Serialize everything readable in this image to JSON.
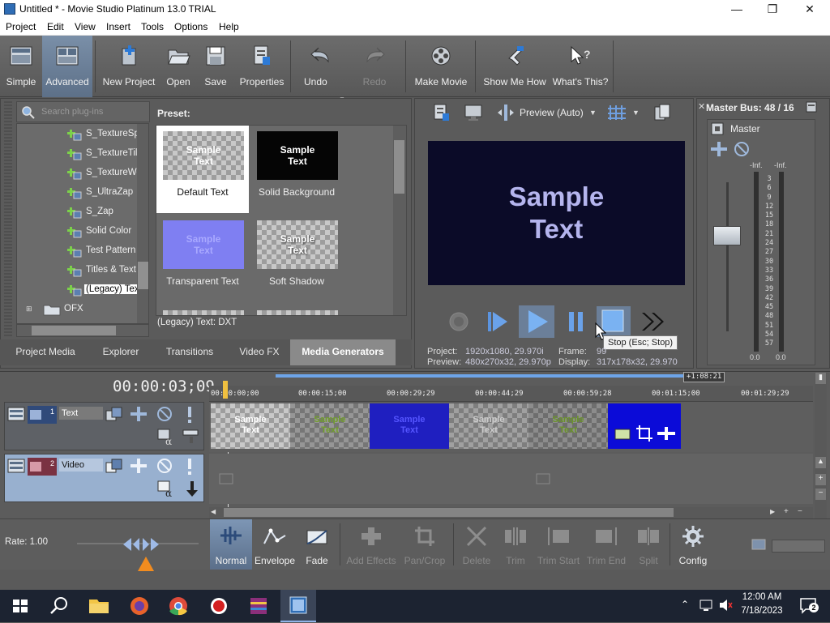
{
  "window": {
    "title": "Untitled * - Movie Studio Platinum 13.0 TRIAL",
    "min": "—",
    "max": "❐",
    "close": "✕"
  },
  "menu": [
    "Project",
    "Edit",
    "View",
    "Insert",
    "Tools",
    "Options",
    "Help"
  ],
  "toolbar": {
    "simple": "Simple",
    "advanced": "Advanced",
    "new_project": "New Project",
    "open": "Open",
    "save": "Save",
    "properties": "Properties",
    "undo": "Undo",
    "redo": "Redo",
    "make_movie": "Make Movie",
    "show_me_how": "Show Me How",
    "whats_this": "What's This?"
  },
  "plugins": {
    "search_placeholder": "Search plug-ins",
    "items": [
      "S_TextureSp",
      "S_TextureTil",
      "S_TextureWe",
      "S_UltraZap",
      "S_Zap",
      "Solid Color",
      "Test Pattern",
      "Titles & Text",
      "(Legacy) Tex"
    ],
    "folder": "OFX"
  },
  "presets": {
    "label": "Preset:",
    "items": [
      {
        "name": "Default Text",
        "thumb": "Sample\nText"
      },
      {
        "name": "Solid Background",
        "thumb": "Sample\nText"
      },
      {
        "name": "Transparent Text",
        "thumb": "Sample\nText"
      },
      {
        "name": "Soft Shadow",
        "thumb": "Sample\nText"
      }
    ],
    "status": "(Legacy) Text: DXT"
  },
  "left_tabs": [
    "Project Media",
    "Explorer",
    "Transitions",
    "Video FX",
    "Media Generators"
  ],
  "preview": {
    "mode": "Preview (Auto)",
    "screen_text_1": "Sample",
    "screen_text_2": "Text",
    "project_label": "Project:",
    "project_value": "1920x1080, 29.970i",
    "preview_label": "Preview:",
    "preview_value": "480x270x32, 29.970p",
    "frame_label": "Frame:",
    "frame_value": "99",
    "display_label": "Display:",
    "display_value": "317x178x32, 29.970",
    "tooltip": "Stop (Esc; Stop)"
  },
  "mixer": {
    "title": "Master Bus: 48 / 16",
    "master": "Master",
    "inf_left": "-Inf.",
    "inf_right": "-Inf.",
    "scale": [
      "3",
      "6",
      "9",
      "12",
      "15",
      "18",
      "21",
      "24",
      "27",
      "30",
      "33",
      "36",
      "39",
      "42",
      "45",
      "48",
      "51",
      "54",
      "57"
    ],
    "bottom_left": "0.0",
    "bottom_right": "0.0"
  },
  "timeline": {
    "timecode": "00:00:03;09",
    "duration": "+1:08:21",
    "ruler": [
      "00:00:00;00",
      "00:00:15;00",
      "00:00:29;29",
      "00:00:44;29",
      "00:00:59;28",
      "00:01:15;00",
      "00:01:29;29"
    ],
    "tracks": [
      {
        "num": "1",
        "name": "Text"
      },
      {
        "num": "2",
        "name": "Video"
      }
    ],
    "clip_text": "Sample\nText",
    "rate": "Rate: 1.00"
  },
  "bottom_toolbar": {
    "normal": "Normal",
    "envelope": "Envelope",
    "fade": "Fade",
    "add_effects": "Add Effects",
    "pan_crop": "Pan/Crop",
    "delete": "Delete",
    "trim": "Trim",
    "trim_start": "Trim Start",
    "trim_end": "Trim End",
    "split": "Split",
    "config": "Config"
  },
  "taskbar": {
    "time": "12:00 AM",
    "date": "7/18/2023",
    "notif_count": "2"
  }
}
